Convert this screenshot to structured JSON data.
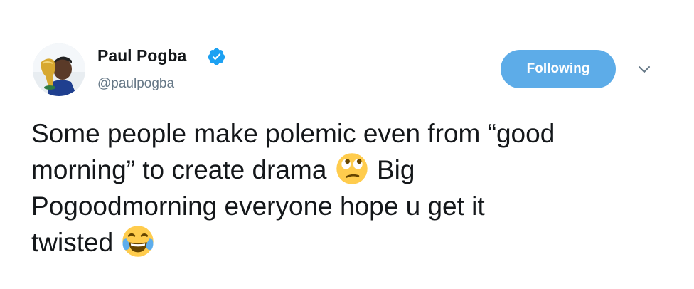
{
  "author": {
    "name": "Paul Pogba",
    "handle": "@paulpogba",
    "verified": true,
    "avatar_icon": "avatar-photo-with-trophy"
  },
  "follow_button": {
    "label": "Following",
    "color": "#5dace8"
  },
  "menu_icon": "chevron-down-icon",
  "tweet": {
    "line1": "Some people make polemic even from “good",
    "line2a": "morning” to create drama",
    "line2b": "Big",
    "line3": "Pogoodmorning everyone hope u get it",
    "line4": "twisted",
    "emoji1": "face-with-rolling-eyes",
    "emoji2": "face-with-tears-of-joy"
  },
  "colors": {
    "text": "#14171a",
    "secondary": "#657786",
    "verified": "#1da1f2",
    "emoji_yellow": "#ffcc4d"
  }
}
